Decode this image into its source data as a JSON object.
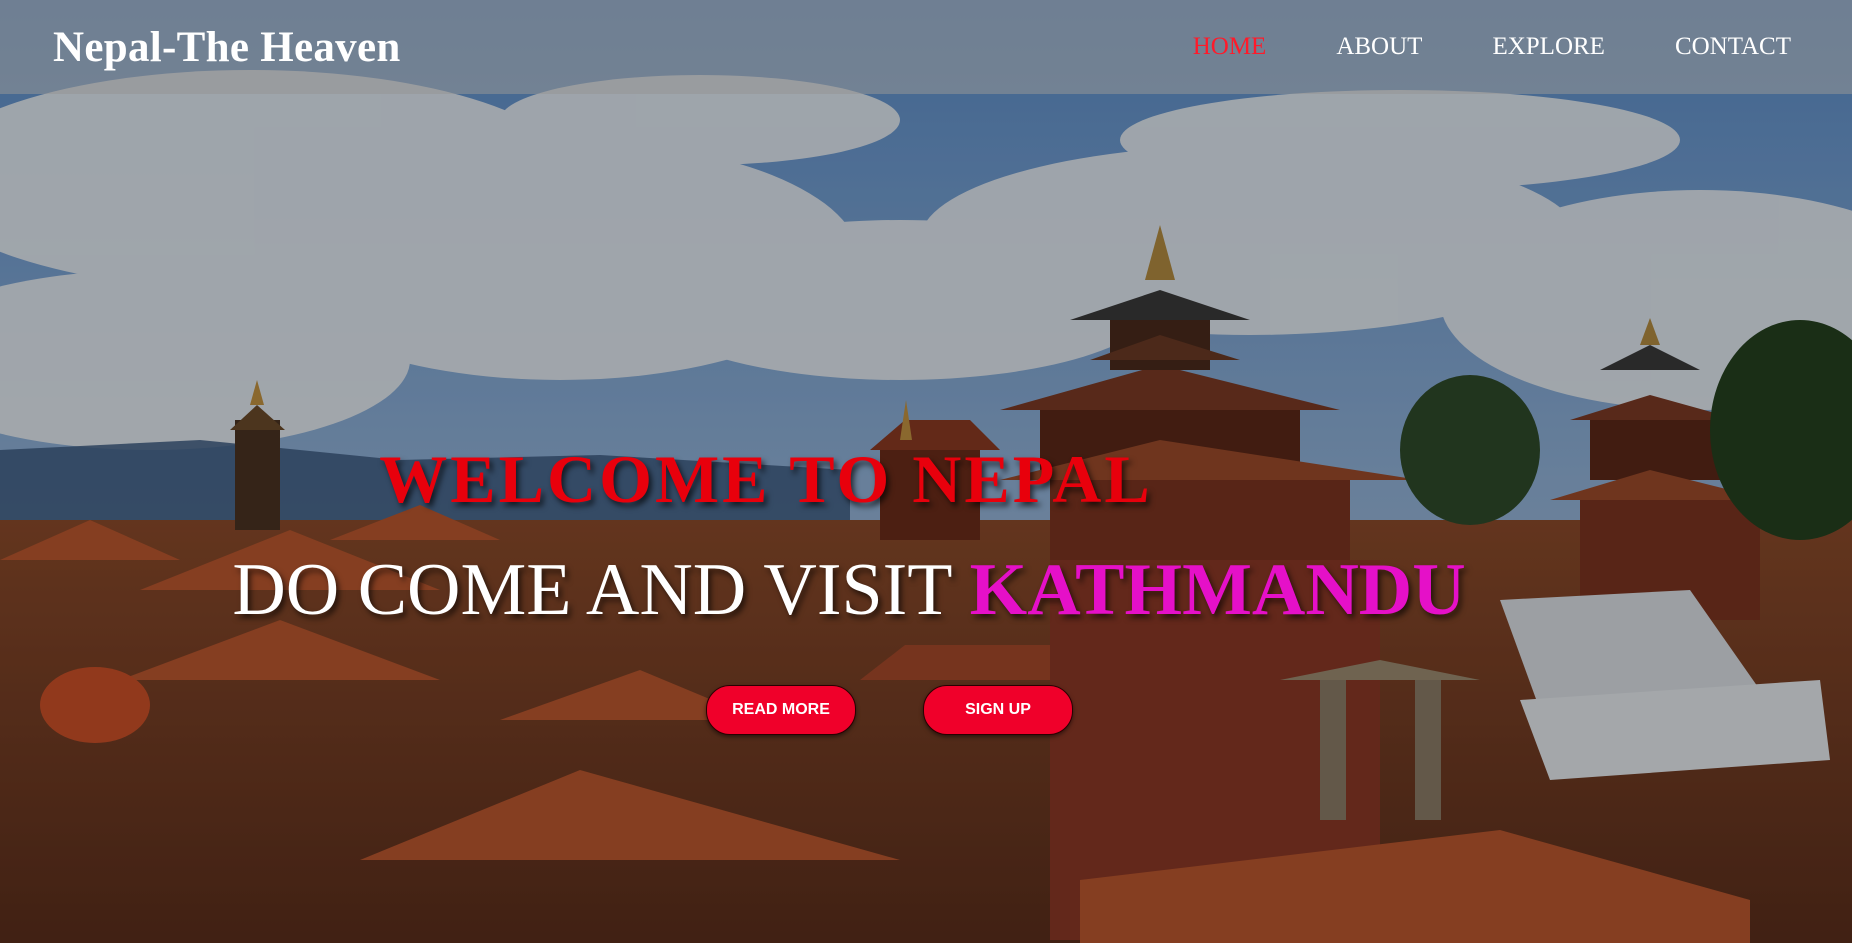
{
  "navbar": {
    "brand": "Nepal-The Heaven",
    "links": [
      {
        "label": "HOME",
        "active": true
      },
      {
        "label": "ABOUT",
        "active": false
      },
      {
        "label": "EXPLORE",
        "active": false
      },
      {
        "label": "CONTACT",
        "active": false
      }
    ]
  },
  "hero": {
    "headline": "WELCOME TO NEPAL",
    "subheadline_prefix": "DO COME AND VISIT ",
    "subheadline_highlight": "KATHMANDU",
    "buttons": {
      "read_more": "READ MORE",
      "sign_up": "SIGN UP"
    }
  },
  "colors": {
    "nav_active": "#ff1a2a",
    "headline": "#e8000c",
    "highlight": "#e510c8",
    "button": "#f0002a"
  }
}
